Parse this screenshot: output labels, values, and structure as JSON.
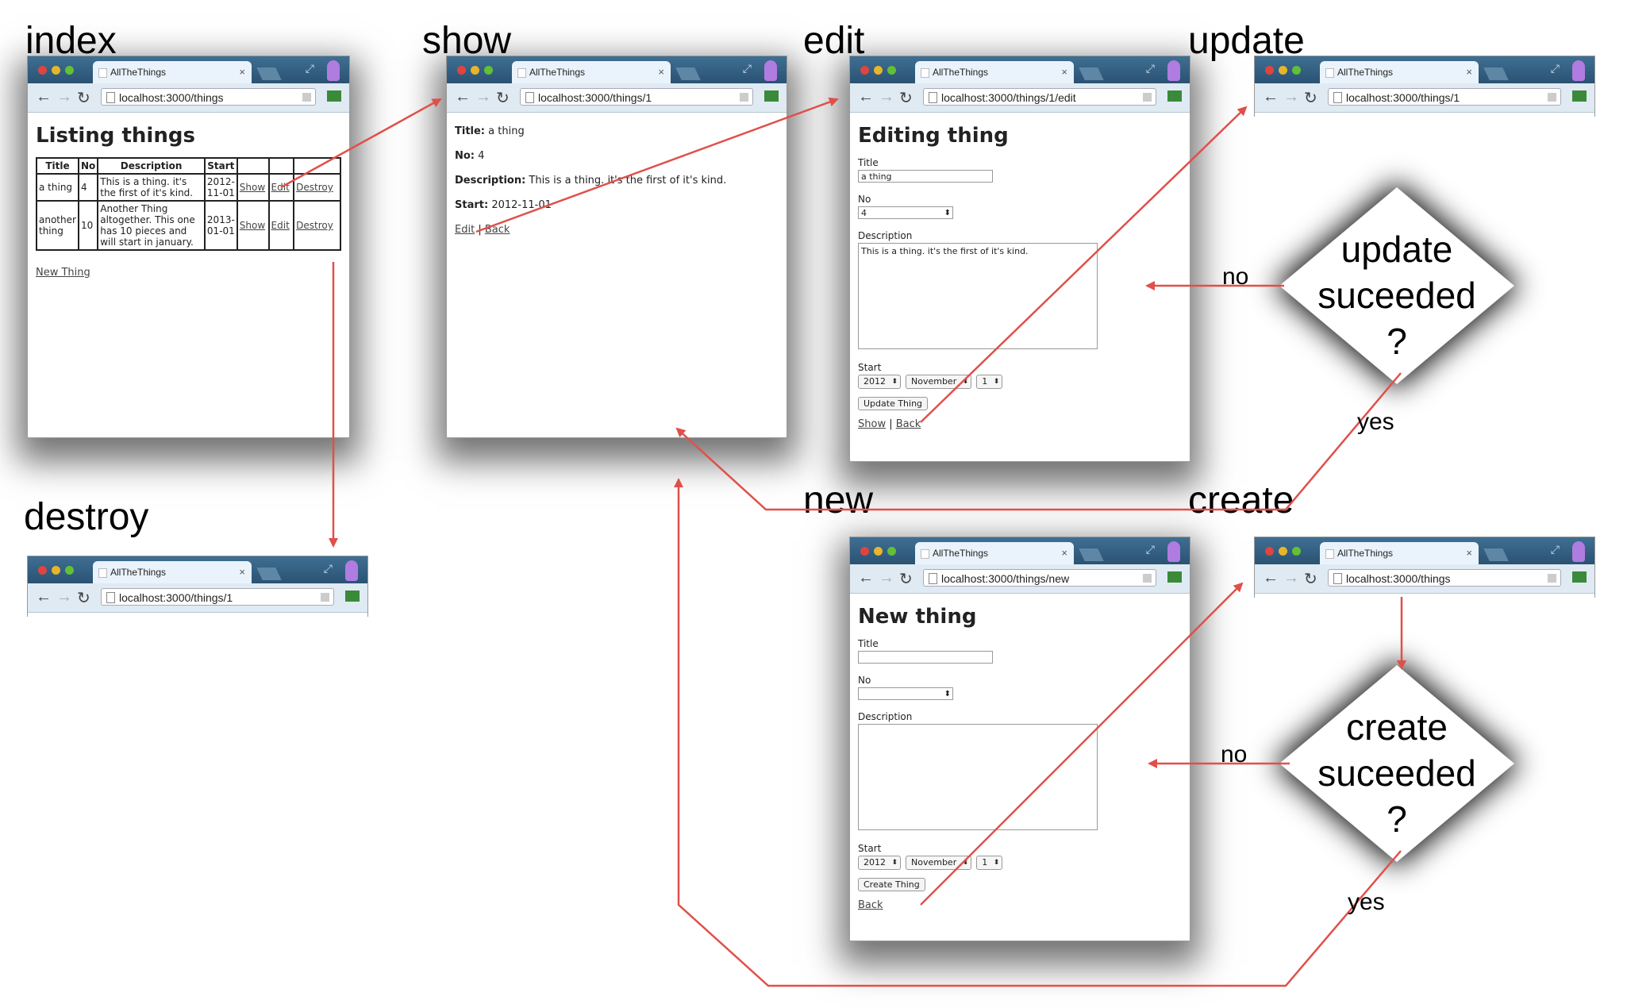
{
  "labels": {
    "index": "index",
    "show": "show",
    "edit": "edit",
    "update": "update",
    "destroy": "destroy",
    "new": "new",
    "create": "create"
  },
  "browser": {
    "tab_title": "AllTheThings",
    "tab_close": "×"
  },
  "index": {
    "url": "localhost:3000/things",
    "heading": "Listing things",
    "columns": [
      "Title",
      "No",
      "Description",
      "Start",
      "",
      ""
    ],
    "rows": [
      {
        "title": "a thing",
        "no": "4",
        "description": "This is a thing. it's the first of it's kind.",
        "start": "2012-11-01"
      },
      {
        "title": "another thing",
        "no": "10",
        "description": "Another Thing altogether. This one has 10 pieces and will start in january.",
        "start": "2013-01-01"
      }
    ],
    "row_links": {
      "show": "Show",
      "edit": "Edit",
      "destroy": "Destroy"
    },
    "new_link": "New Thing"
  },
  "show": {
    "url": "localhost:3000/things/1",
    "title_label": "Title:",
    "title_value": "a thing",
    "no_label": "No:",
    "no_value": "4",
    "desc_label": "Description:",
    "desc_value": "This is a thing. it's the first of it's kind.",
    "start_label": "Start:",
    "start_value": "2012-11-01",
    "edit_link": "Edit",
    "sep": "|",
    "back_link": "Back"
  },
  "edit": {
    "url": "localhost:3000/things/1/edit",
    "heading": "Editing thing",
    "title_label": "Title",
    "title_value": "a thing",
    "no_label": "No",
    "no_value": "4",
    "desc_label": "Description",
    "desc_value": "This is a thing. it's the first of it's kind.",
    "start_label": "Start",
    "year": "2012",
    "month": "November",
    "day": "1",
    "submit": "Update Thing",
    "show_link": "Show",
    "sep": "|",
    "back_link": "Back"
  },
  "update": {
    "url": "localhost:3000/things/1"
  },
  "destroy": {
    "url": "localhost:3000/things/1"
  },
  "new": {
    "url": "localhost:3000/things/new",
    "heading": "New thing",
    "title_label": "Title",
    "no_label": "No",
    "desc_label": "Description",
    "start_label": "Start",
    "year": "2012",
    "month": "November",
    "day": "1",
    "submit": "Create Thing",
    "back_link": "Back"
  },
  "create": {
    "url": "localhost:3000/things"
  },
  "decisions": {
    "update": {
      "line1": "update",
      "line2": "suceeded",
      "line3": "?"
    },
    "create": {
      "line1": "create",
      "line2": "suceeded",
      "line3": "?"
    }
  },
  "edges": {
    "update_no": "no",
    "update_yes": "yes",
    "create_no": "no",
    "create_yes": "yes"
  },
  "colors": {
    "arrow": "#e0504a",
    "shadow": "#000000"
  }
}
